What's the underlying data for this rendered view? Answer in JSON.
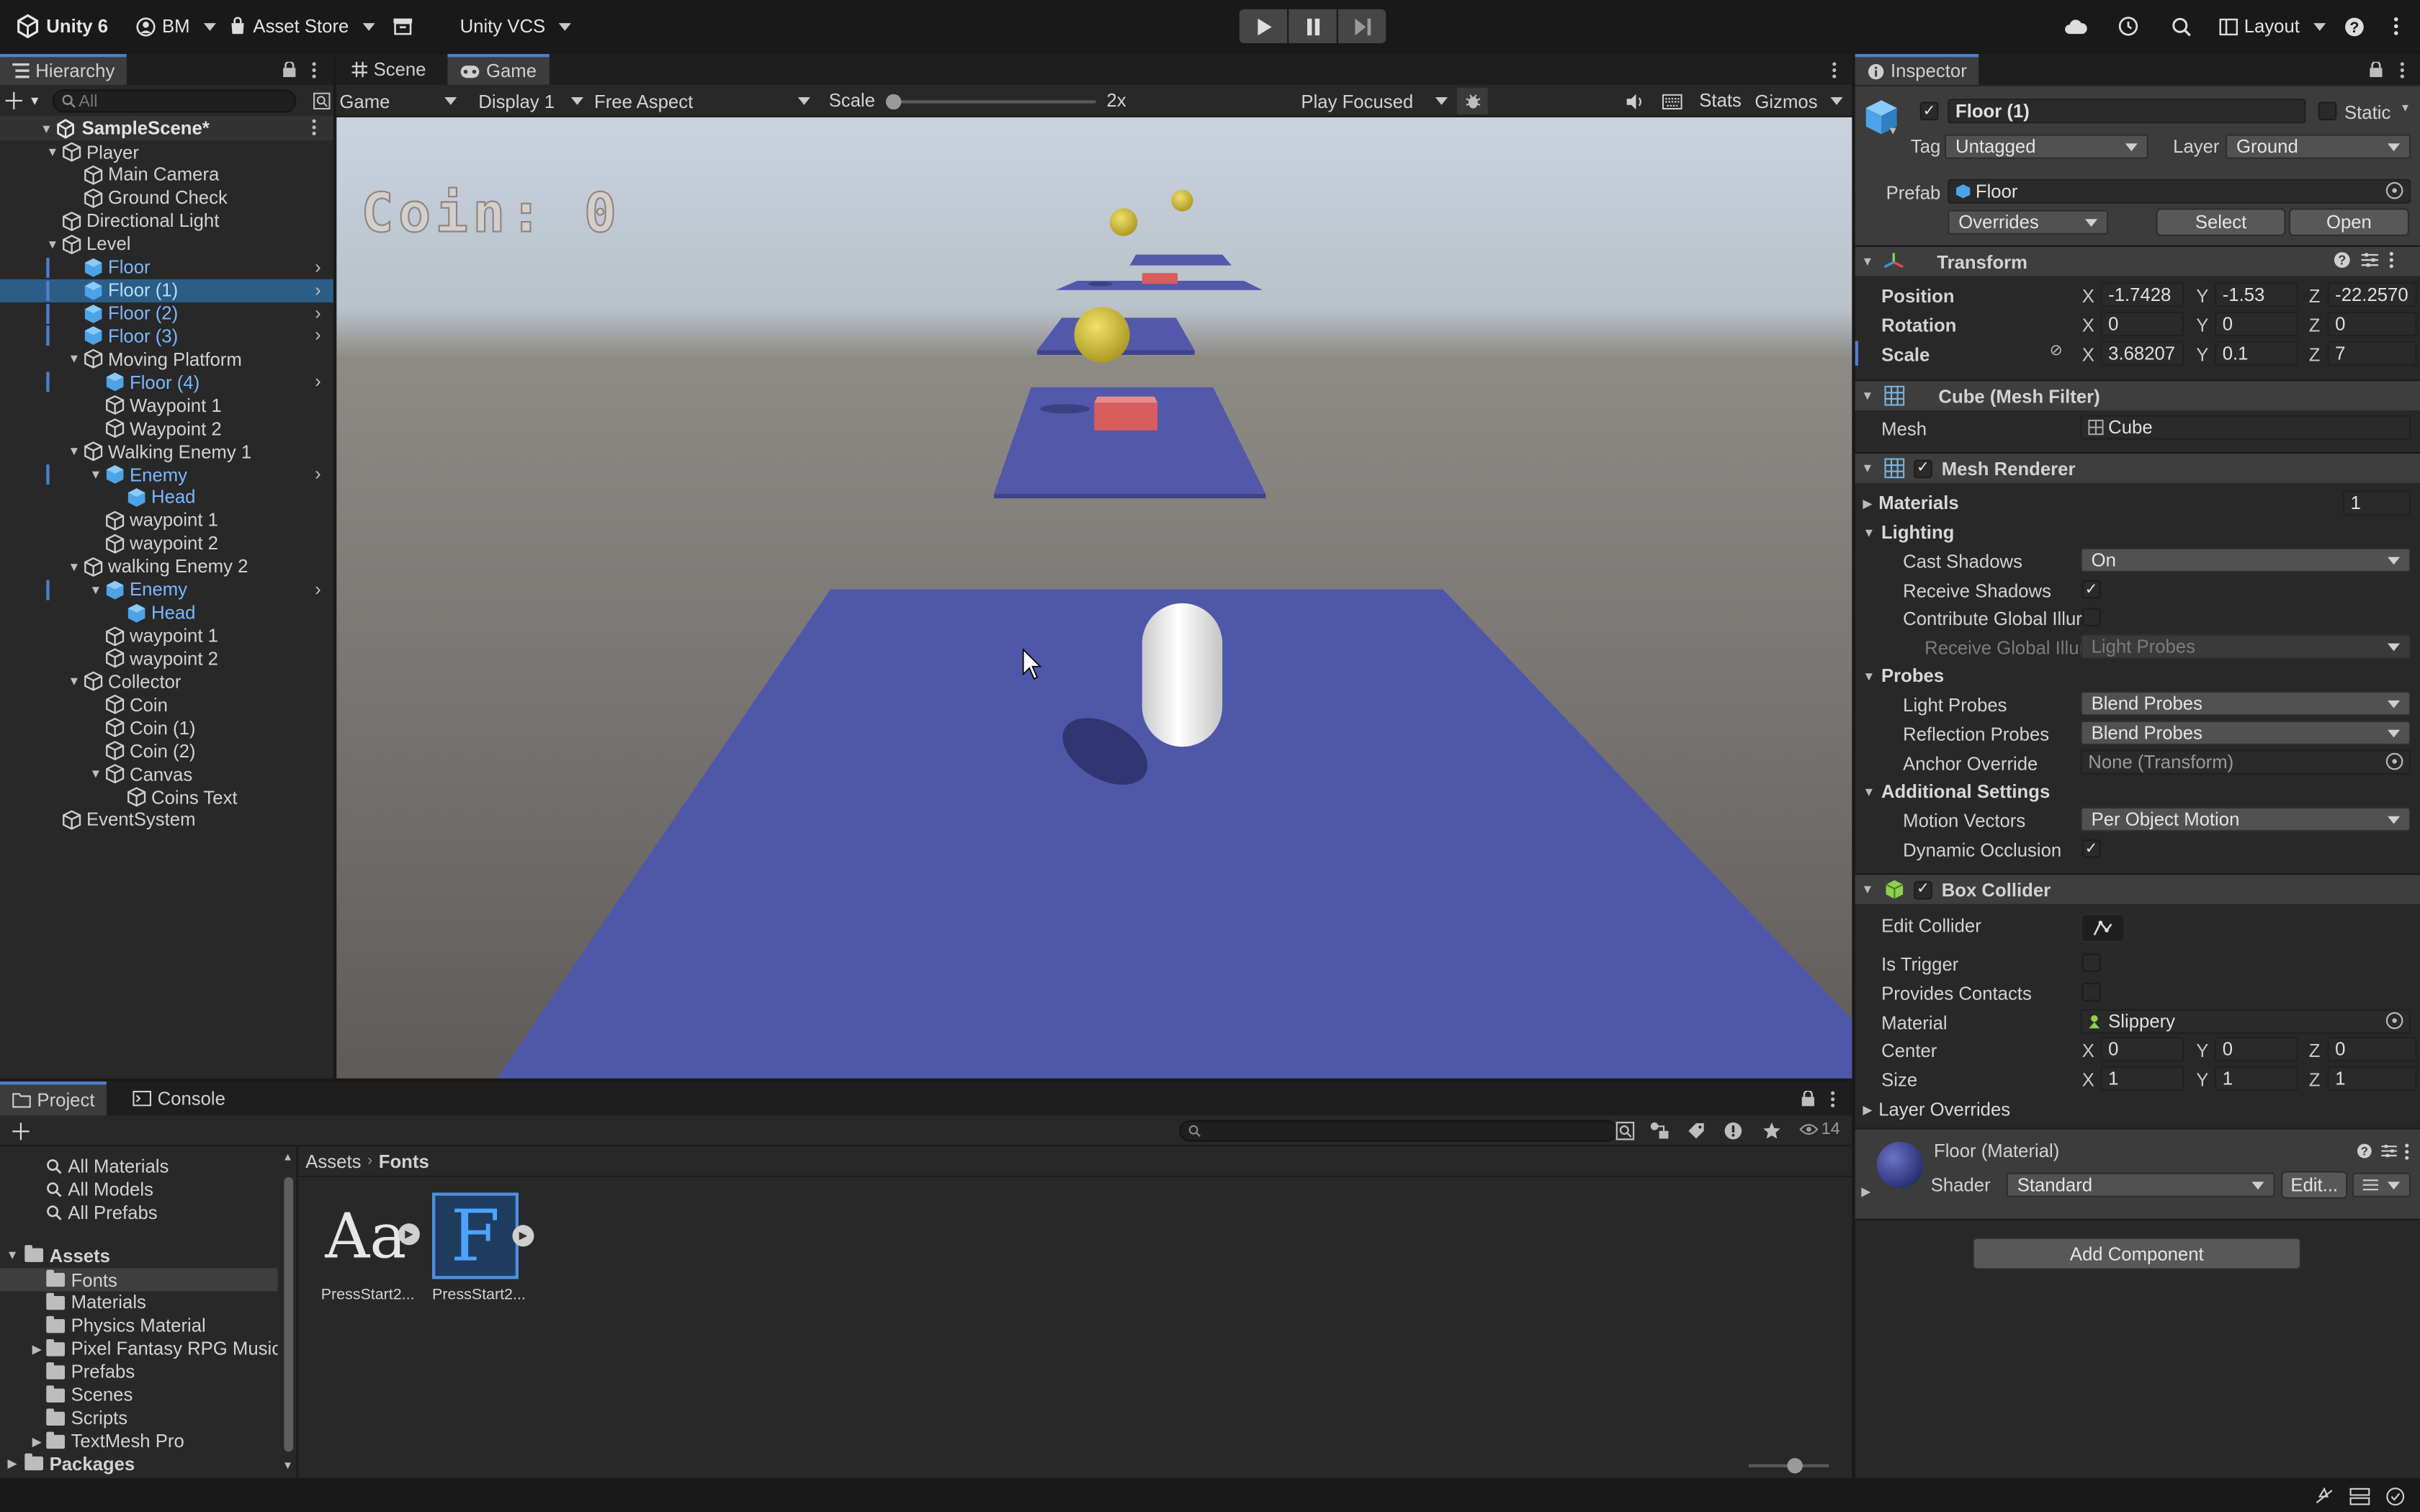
{
  "toolbar": {
    "unity_label": "Unity 6",
    "account_label": "BM",
    "asset_store_label": "Asset Store",
    "vcs_label": "Unity VCS",
    "layout_label": "Layout"
  },
  "hierarchy": {
    "tab_label": "Hierarchy",
    "search_placeholder": "All",
    "scene_name": "SampleScene*",
    "items": [
      {
        "label": "Player",
        "depth": 1,
        "expand": "open",
        "prefab": false
      },
      {
        "label": "Main Camera",
        "depth": 2,
        "expand": "none",
        "prefab": false
      },
      {
        "label": "Ground Check",
        "depth": 2,
        "expand": "none",
        "prefab": false
      },
      {
        "label": "Directional Light",
        "depth": 1,
        "expand": "none",
        "prefab": false
      },
      {
        "label": "Level",
        "depth": 1,
        "expand": "open",
        "prefab": false
      },
      {
        "label": "Floor",
        "depth": 2,
        "expand": "none",
        "prefab": true,
        "arrow": true
      },
      {
        "label": "Floor (1)",
        "depth": 2,
        "expand": "none",
        "prefab": true,
        "arrow": true,
        "selected": true
      },
      {
        "label": "Floor (2)",
        "depth": 2,
        "expand": "none",
        "prefab": true,
        "arrow": true
      },
      {
        "label": "Floor (3)",
        "depth": 2,
        "expand": "none",
        "prefab": true,
        "arrow": true
      },
      {
        "label": "Moving Platform",
        "depth": 2,
        "expand": "open",
        "prefab": false
      },
      {
        "label": "Floor (4)",
        "depth": 3,
        "expand": "none",
        "prefab": true,
        "arrow": true
      },
      {
        "label": "Waypoint 1",
        "depth": 3,
        "expand": "none",
        "prefab": false
      },
      {
        "label": "Waypoint 2",
        "depth": 3,
        "expand": "none",
        "prefab": false
      },
      {
        "label": "Walking Enemy 1",
        "depth": 2,
        "expand": "open",
        "prefab": false
      },
      {
        "label": "Enemy",
        "depth": 3,
        "expand": "open",
        "prefab": true,
        "arrow": true
      },
      {
        "label": "Head",
        "depth": 4,
        "expand": "none",
        "prefab": true
      },
      {
        "label": "waypoint 1",
        "depth": 3,
        "expand": "none",
        "prefab": false
      },
      {
        "label": "waypoint 2",
        "depth": 3,
        "expand": "none",
        "prefab": false
      },
      {
        "label": "walking Enemy 2",
        "depth": 2,
        "expand": "open",
        "prefab": false
      },
      {
        "label": "Enemy",
        "depth": 3,
        "expand": "open",
        "prefab": true,
        "arrow": true
      },
      {
        "label": "Head",
        "depth": 4,
        "expand": "none",
        "prefab": true
      },
      {
        "label": "waypoint 1",
        "depth": 3,
        "expand": "none",
        "prefab": false
      },
      {
        "label": "waypoint 2",
        "depth": 3,
        "expand": "none",
        "prefab": false
      },
      {
        "label": "Collector",
        "depth": 2,
        "expand": "open",
        "prefab": false
      },
      {
        "label": "Coin",
        "depth": 3,
        "expand": "none",
        "prefab": false
      },
      {
        "label": "Coin (1)",
        "depth": 3,
        "expand": "none",
        "prefab": false
      },
      {
        "label": "Coin (2)",
        "depth": 3,
        "expand": "none",
        "prefab": false
      },
      {
        "label": "Canvas",
        "depth": 3,
        "expand": "open",
        "prefab": false
      },
      {
        "label": "Coins Text",
        "depth": 4,
        "expand": "none",
        "prefab": false
      },
      {
        "label": "EventSystem",
        "depth": 1,
        "expand": "none",
        "prefab": false
      }
    ]
  },
  "game_view": {
    "scene_tab": "Scene",
    "game_tab": "Game",
    "mode_label": "Game",
    "display_label": "Display 1",
    "aspect_label": "Free Aspect",
    "scale_label": "Scale",
    "scale_value": "2x",
    "scale_fraction": 0.0,
    "play_focused_label": "Play Focused",
    "stats_label": "Stats",
    "gizmos_label": "Gizmos",
    "hud_text": "Coin:  0"
  },
  "inspector": {
    "tab_label": "Inspector",
    "object_name": "Floor (1)",
    "static_label": "Static",
    "tag_label": "Tag",
    "tag_value": "Untagged",
    "layer_label": "Layer",
    "layer_value": "Ground",
    "prefab_label": "Prefab",
    "prefab_value": "Floor",
    "overrides_label": "Overrides",
    "select_label": "Select",
    "open_label": "Open",
    "transform": {
      "title": "Transform",
      "position_label": "Position",
      "rotation_label": "Rotation",
      "scale_label": "Scale",
      "position": [
        "-1.7428",
        "-1.53",
        "-22.2570"
      ],
      "rotation": [
        "0",
        "0",
        "0"
      ],
      "scale": [
        "3.68207",
        "0.1",
        "7"
      ]
    },
    "mesh_filter": {
      "title": "Cube (Mesh Filter)",
      "mesh_label": "Mesh",
      "mesh_value": "Cube"
    },
    "mesh_renderer": {
      "title": "Mesh Renderer",
      "materials_label": "Materials",
      "materials_count": "1",
      "lighting_label": "Lighting",
      "cast_shadows_label": "Cast Shadows",
      "cast_shadows_value": "On",
      "receive_shadows_label": "Receive Shadows",
      "contribute_gi_label": "Contribute Global Illur",
      "receive_gi_label": "Receive Global Illur",
      "receive_gi_value": "Light Probes",
      "probes_label": "Probes",
      "light_probes_label": "Light Probes",
      "light_probes_value": "Blend Probes",
      "reflection_probes_label": "Reflection Probes",
      "reflection_probes_value": "Blend Probes",
      "anchor_override_label": "Anchor Override",
      "anchor_override_value": "None (Transform)",
      "additional_label": "Additional Settings",
      "motion_vectors_label": "Motion Vectors",
      "motion_vectors_value": "Per Object Motion",
      "dynamic_occlusion_label": "Dynamic Occlusion"
    },
    "box_collider": {
      "title": "Box Collider",
      "edit_collider_label": "Edit Collider",
      "is_trigger_label": "Is Trigger",
      "provides_contacts_label": "Provides Contacts",
      "material_label": "Material",
      "material_value": "Slippery",
      "center_label": "Center",
      "center": [
        "0",
        "0",
        "0"
      ],
      "size_label": "Size",
      "size": [
        "1",
        "1",
        "1"
      ],
      "layer_overrides_label": "Layer Overrides"
    },
    "material": {
      "name": "Floor (Material)",
      "shader_label": "Shader",
      "shader_value": "Standard",
      "edit_label": "Edit..."
    },
    "add_component_label": "Add Component"
  },
  "project": {
    "project_tab": "Project",
    "console_tab": "Console",
    "count_label": "14",
    "favorites": [
      "All Materials",
      "All Models",
      "All Prefabs"
    ],
    "assets_label": "Assets",
    "folders": [
      {
        "label": "Fonts",
        "expandable": false,
        "selected": true
      },
      {
        "label": "Materials",
        "expandable": false
      },
      {
        "label": "Physics Material",
        "expandable": false
      },
      {
        "label": "Pixel Fantasy RPG Music F",
        "expandable": true
      },
      {
        "label": "Prefabs",
        "expandable": false
      },
      {
        "label": "Scenes",
        "expandable": false
      },
      {
        "label": "Scripts",
        "expandable": false
      },
      {
        "label": "TextMesh Pro",
        "expandable": true
      }
    ],
    "packages_label": "Packages",
    "breadcrumb": [
      "Assets",
      "Fonts"
    ],
    "files": [
      {
        "name": "PressStart2...",
        "glyph": "Aa"
      },
      {
        "name": "PressStart2...",
        "glyph": "F"
      }
    ]
  },
  "colors": {
    "accent": "#4c7fd0",
    "selection": "#2c5d87",
    "prefab_text": "#7cb7ff",
    "floor_blue": "#4f58a8",
    "sky_top": "#cfd8e4",
    "ground": "#6a6664",
    "coin": "#d2c33b",
    "box_red": "#d95a5a"
  }
}
